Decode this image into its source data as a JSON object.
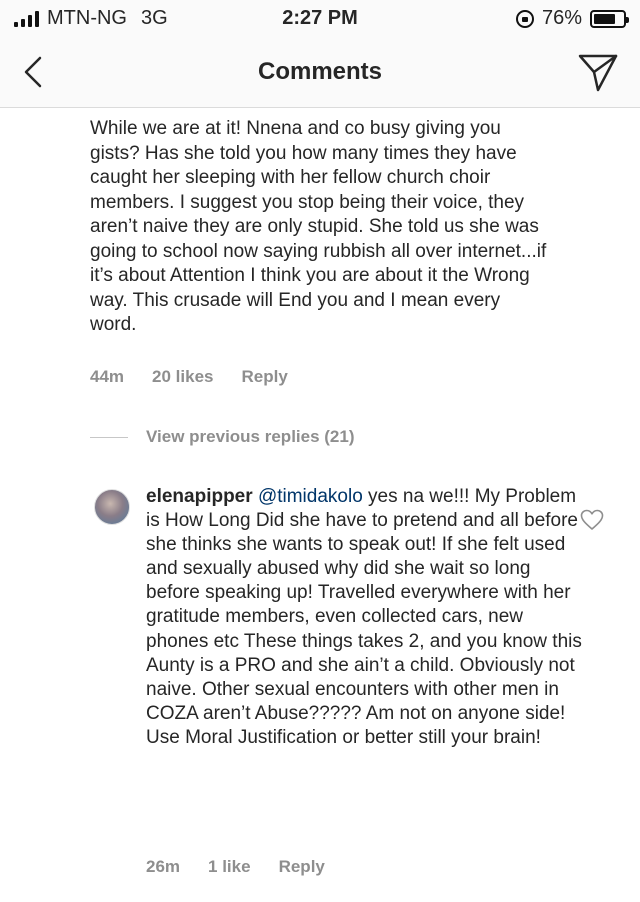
{
  "status_bar": {
    "carrier": "MTN-NG",
    "network": "3G",
    "time": "2:27 PM",
    "battery": "76%",
    "battery_level": 0.76
  },
  "header": {
    "title": "Comments"
  },
  "comment": {
    "text": "While we are at it! Nnena and co busy giving you gists? Has she told you how many times they have caught her sleeping with her fellow church choir members. I suggest you stop being their voice, they aren’t naive they are only stupid. She told us she was going to school now saying rubbish all over internet...if it’s about Attention I think you are about it the Wrong way. This crusade will End you and I mean every word.",
    "time": "44m",
    "likes": "20 likes",
    "reply_label": "Reply"
  },
  "view_previous_replies": "View previous replies (21)",
  "reply": {
    "username": "elenapipper",
    "mention": "@timidakolo",
    "text": " yes na we!!! My Problem is How Long Did she have to pretend and all before she thinks she wants to speak out! If she felt used and sexually abused why did she wait so long before speaking up! Travelled everywhere with her gratitude members, even collected cars, new phones etc These things takes 2, and you know this Aunty is a PRO and she ain’t a child. Obviously not naive. Other sexual encounters with other men in COZA aren’t Abuse????? Am not on anyone side! Use Moral Justification or better still your brain!",
    "time": "26m",
    "likes": "1 like",
    "reply_label": "Reply"
  },
  "icons": {
    "back": "chevron-left-icon",
    "send": "paper-plane-icon",
    "like": "heart-outline-icon"
  }
}
